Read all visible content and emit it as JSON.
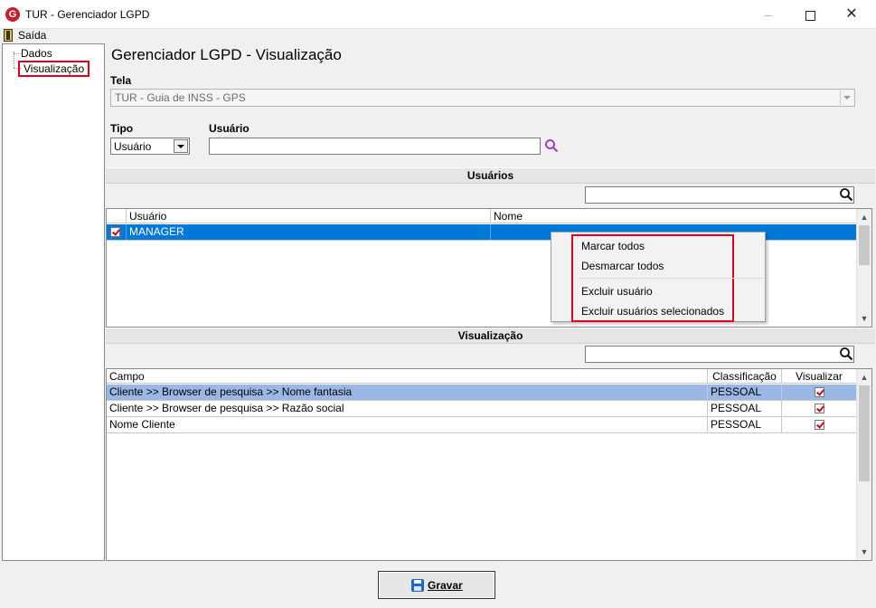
{
  "window": {
    "title": "TUR - Gerenciador LGPD",
    "minimize": "–",
    "close": "✕"
  },
  "menu": {
    "exit_label": "Saída"
  },
  "sidebar": {
    "items": [
      {
        "label": "Dados"
      },
      {
        "label": "Visualização",
        "selected": true
      }
    ]
  },
  "main": {
    "heading": "Gerenciador LGPD - Visualização",
    "tela_label": "Tela",
    "tela_value": "TUR - Guia de INSS - GPS",
    "tipo_label": "Tipo",
    "tipo_value": "Usuário",
    "usuario_label": "Usuário",
    "usuario_value": ""
  },
  "usuarios_section": {
    "title": "Usuários",
    "columns": [
      "Usuário",
      "Nome"
    ],
    "rows": [
      {
        "usuario": "MANAGER",
        "nome": "",
        "checked": true,
        "selected": true
      }
    ]
  },
  "context_menu": {
    "items": [
      "Marcar todos",
      "Desmarcar todos",
      "Excluir usuário",
      "Excluir usuários selecionados"
    ]
  },
  "visualizacao_section": {
    "title": "Visualização",
    "columns": [
      "Campo",
      "Classificação",
      "Visualizar"
    ],
    "rows": [
      {
        "campo": "Cliente >> Browser de pesquisa >> Nome fantasia",
        "classificacao": "PESSOAL",
        "visualizar": true
      },
      {
        "campo": "Cliente >> Browser de pesquisa >> Razão social",
        "classificacao": "PESSOAL",
        "visualizar": true
      },
      {
        "campo": "Nome Cliente",
        "classificacao": "PESSOAL",
        "visualizar": true
      }
    ]
  },
  "footer": {
    "save_label": "Gravar"
  },
  "colors": {
    "selection": "#0078d7",
    "highlight_row": "#9ab8e6",
    "annotation_red": "#e0001a",
    "brand": "#c8202a"
  }
}
